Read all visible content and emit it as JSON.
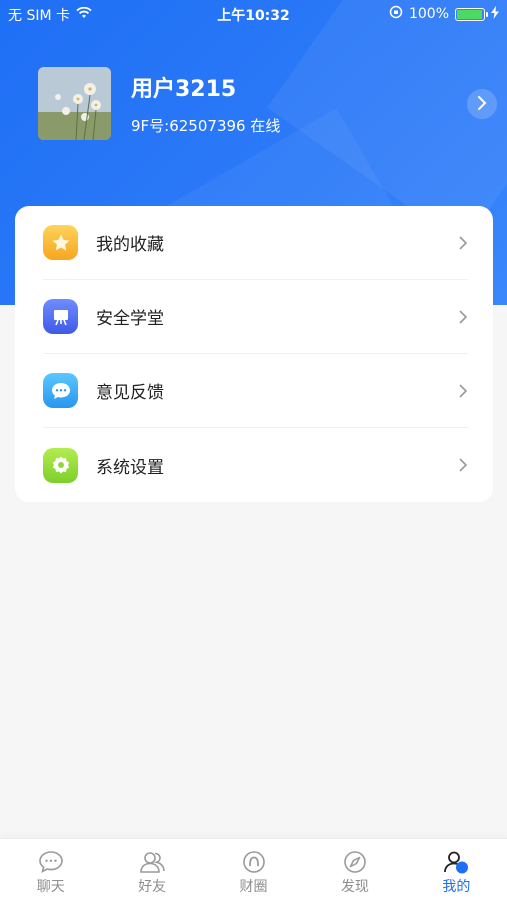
{
  "status_bar": {
    "carrier": "无 SIM 卡",
    "time": "上午10:32",
    "battery": "100%"
  },
  "profile": {
    "name": "用户3215",
    "id_line": "9F号:62507396 在线"
  },
  "menu": [
    {
      "label": "我的收藏",
      "icon": "star-icon",
      "color": "#f7b733"
    },
    {
      "label": "安全学堂",
      "icon": "presentation-icon",
      "color": "#4f6cf4"
    },
    {
      "label": "意见反馈",
      "icon": "chat-bubble-icon",
      "color": "#2fa7f0"
    },
    {
      "label": "系统设置",
      "icon": "gear-icon",
      "color": "#8fd83a"
    }
  ],
  "tabs": [
    {
      "label": "聊天",
      "icon": "chat-icon",
      "active": false
    },
    {
      "label": "好友",
      "icon": "friends-icon",
      "active": false
    },
    {
      "label": "财圈",
      "icon": "circle-icon",
      "active": false
    },
    {
      "label": "发现",
      "icon": "compass-icon",
      "active": false
    },
    {
      "label": "我的",
      "icon": "profile-icon",
      "active": true
    }
  ],
  "colors": {
    "primary": "#1f6ff5",
    "inactive_tab": "#8e8e8e"
  }
}
